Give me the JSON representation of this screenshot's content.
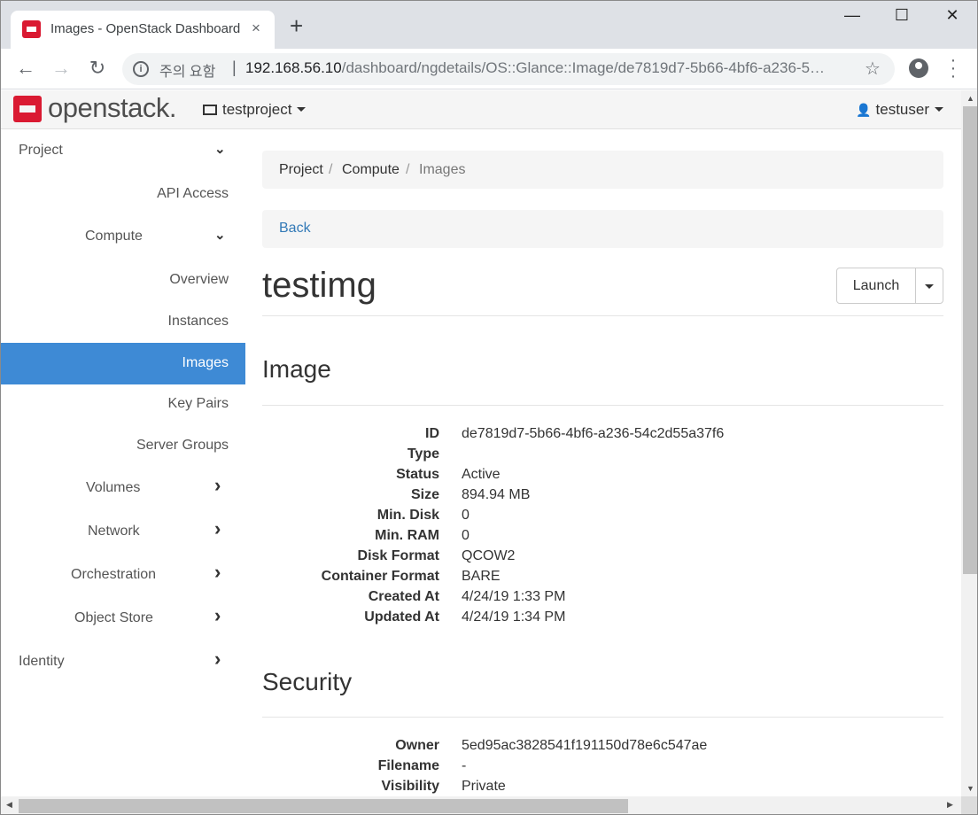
{
  "browser": {
    "tab_title": "Images - OpenStack Dashboard",
    "tab_close": "×",
    "new_tab": "+",
    "url_warning": "주의 요함",
    "url_separator": "|",
    "url_host": "192.168.56.10",
    "url_path": "/dashboard/ngdetails/OS::Glance::Image/de7819d7-5b66-4bf6-a236-5…",
    "window_controls": {
      "minimize": "—",
      "maximize": "☐",
      "close": "✕"
    }
  },
  "header": {
    "logo_text": "openstack.",
    "project": "testproject",
    "user": "testuser"
  },
  "sidebar": {
    "items": [
      {
        "label": "Project",
        "chevron": "⌄"
      },
      {
        "label": "API Access",
        "chevron": ""
      },
      {
        "label": "Compute",
        "chevron": "⌄"
      },
      {
        "label": "Overview",
        "chevron": ""
      },
      {
        "label": "Instances",
        "chevron": ""
      },
      {
        "label": "Images",
        "chevron": ""
      },
      {
        "label": "Key Pairs",
        "chevron": ""
      },
      {
        "label": "Server Groups",
        "chevron": ""
      },
      {
        "label": "Volumes",
        "chevron": "›"
      },
      {
        "label": "Network",
        "chevron": "›"
      },
      {
        "label": "Orchestration",
        "chevron": "›"
      },
      {
        "label": "Object Store",
        "chevron": "›"
      },
      {
        "label": "Identity",
        "chevron": "›"
      }
    ]
  },
  "breadcrumb": {
    "items": [
      "Project",
      "Compute",
      "Images"
    ],
    "separator": "/"
  },
  "back_label": "Back",
  "page_title": "testimg",
  "launch_label": "Launch",
  "image_section": {
    "title": "Image",
    "rows": [
      {
        "key": "ID",
        "value": "de7819d7-5b66-4bf6-a236-54c2d55a37f6"
      },
      {
        "key": "Type",
        "value": ""
      },
      {
        "key": "Status",
        "value": "Active"
      },
      {
        "key": "Size",
        "value": "894.94 MB"
      },
      {
        "key": "Min. Disk",
        "value": "0"
      },
      {
        "key": "Min. RAM",
        "value": "0"
      },
      {
        "key": "Disk Format",
        "value": "QCOW2"
      },
      {
        "key": "Container Format",
        "value": "BARE"
      },
      {
        "key": "Created At",
        "value": "4/24/19 1:33 PM"
      },
      {
        "key": "Updated At",
        "value": "4/24/19 1:34 PM"
      }
    ]
  },
  "security_section": {
    "title": "Security",
    "rows": [
      {
        "key": "Owner",
        "value": "5ed95ac3828541f191150d78e6c547ae"
      },
      {
        "key": "Filename",
        "value": "-"
      },
      {
        "key": "Visibility",
        "value": "Private"
      }
    ]
  }
}
